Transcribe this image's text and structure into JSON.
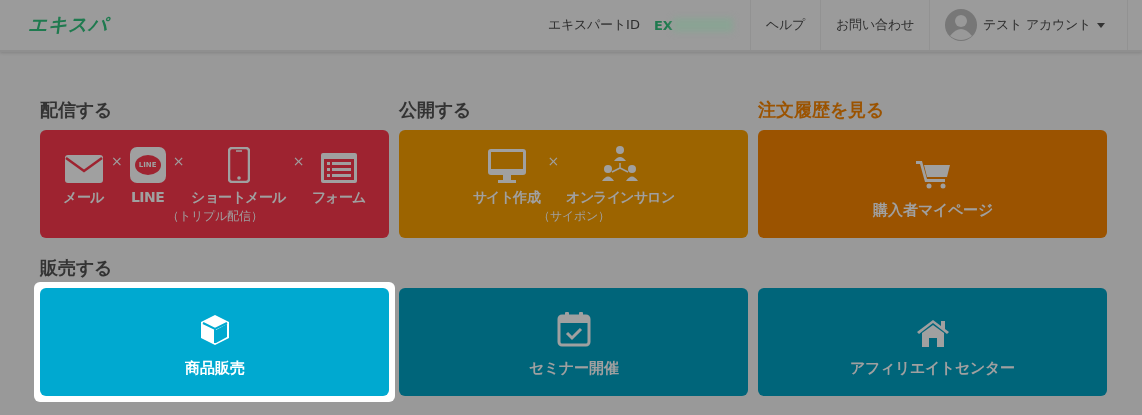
{
  "header": {
    "logo": "エキスパ",
    "nav": [
      {
        "kind": "id",
        "label": "エキスパートID",
        "value": "EX"
      },
      {
        "kind": "link",
        "label": "ヘルプ"
      },
      {
        "kind": "link",
        "label": "お問い合わせ"
      },
      {
        "kind": "account",
        "label": "テスト アカウント"
      }
    ]
  },
  "rows": [
    {
      "title": null,
      "columns": [
        {
          "title": "配信する",
          "accent": false,
          "card": {
            "color": "#9e2330",
            "selected": false,
            "items": [
              {
                "label": "メール"
              },
              {
                "separator": "×",
                "label": "LINE",
                "icon_text": "LINE"
              },
              {
                "separator": "×",
                "label": "ショートメール"
              },
              {
                "separator": "×",
                "label": "フォーム"
              }
            ],
            "note": "（トリプル配信）"
          }
        },
        {
          "title": "公開する",
          "accent": false,
          "card": {
            "color": "#9c6400",
            "selected": false,
            "items": [
              {
                "label": "サイト作成"
              },
              {
                "separator": "×",
                "label": "オンラインサロン"
              }
            ],
            "note": "（サイポン）"
          }
        },
        {
          "title": "注文履歴を見る",
          "accent": true,
          "card": {
            "color": "#9b5300",
            "selected": false,
            "items": [
              {
                "label": "購入者マイページ"
              }
            ]
          }
        }
      ]
    },
    {
      "title": "販売する",
      "columns": [
        {
          "card": {
            "color": "#00a9d0",
            "selected": true,
            "items": [
              {
                "label": "商品販売"
              }
            ]
          }
        },
        {
          "card": {
            "color": "#00657a",
            "selected": false,
            "items": [
              {
                "label": "セミナー開催"
              }
            ]
          }
        },
        {
          "card": {
            "color": "#00657a",
            "selected": false,
            "items": [
              {
                "label": "アフィリエイトセンター"
              }
            ]
          }
        }
      ]
    }
  ]
}
